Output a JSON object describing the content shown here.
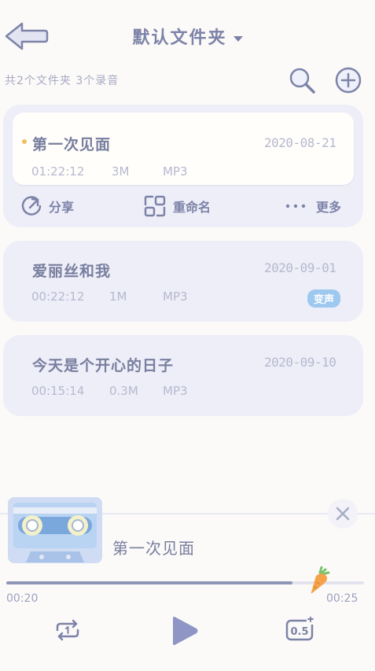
{
  "header": {
    "folder_title": "默认文件夹",
    "summary": "共2个文件夹  3个录音"
  },
  "recordings": [
    {
      "title": "第一次见面",
      "date": "2020-08-21",
      "duration": "01:22:12",
      "size": "3M",
      "format": "MP3",
      "tag": ""
    },
    {
      "title": "爱丽丝和我",
      "date": "2020-09-01",
      "duration": "00:22:12",
      "size": "1M",
      "format": "MP3",
      "tag": "变声"
    },
    {
      "title": "今天是个开心的日子",
      "date": "2020-09-10",
      "duration": "00:15:14",
      "size": "0.3M",
      "format": "MP3",
      "tag": ""
    }
  ],
  "actions": {
    "share": "分享",
    "rename": "重命名",
    "more": "更多"
  },
  "player": {
    "title": "第一次见面",
    "current_time": "00:20",
    "total_time": "00:25",
    "progress": 0.8,
    "speed_label": "0.5"
  },
  "colors": {
    "accent": "#7d83a8",
    "tag_blue": "#9dc8ef",
    "dot_orange": "#f2bd5e",
    "card_bg": "#eeeef8"
  },
  "icons": [
    "back-arrow-icon",
    "chevron-down-icon",
    "search-icon",
    "add-icon",
    "share-icon",
    "rename-icon",
    "more-icon",
    "close-icon",
    "cassette-icon",
    "carrot-icon",
    "repeat-one-icon",
    "play-icon",
    "speed-icon"
  ]
}
